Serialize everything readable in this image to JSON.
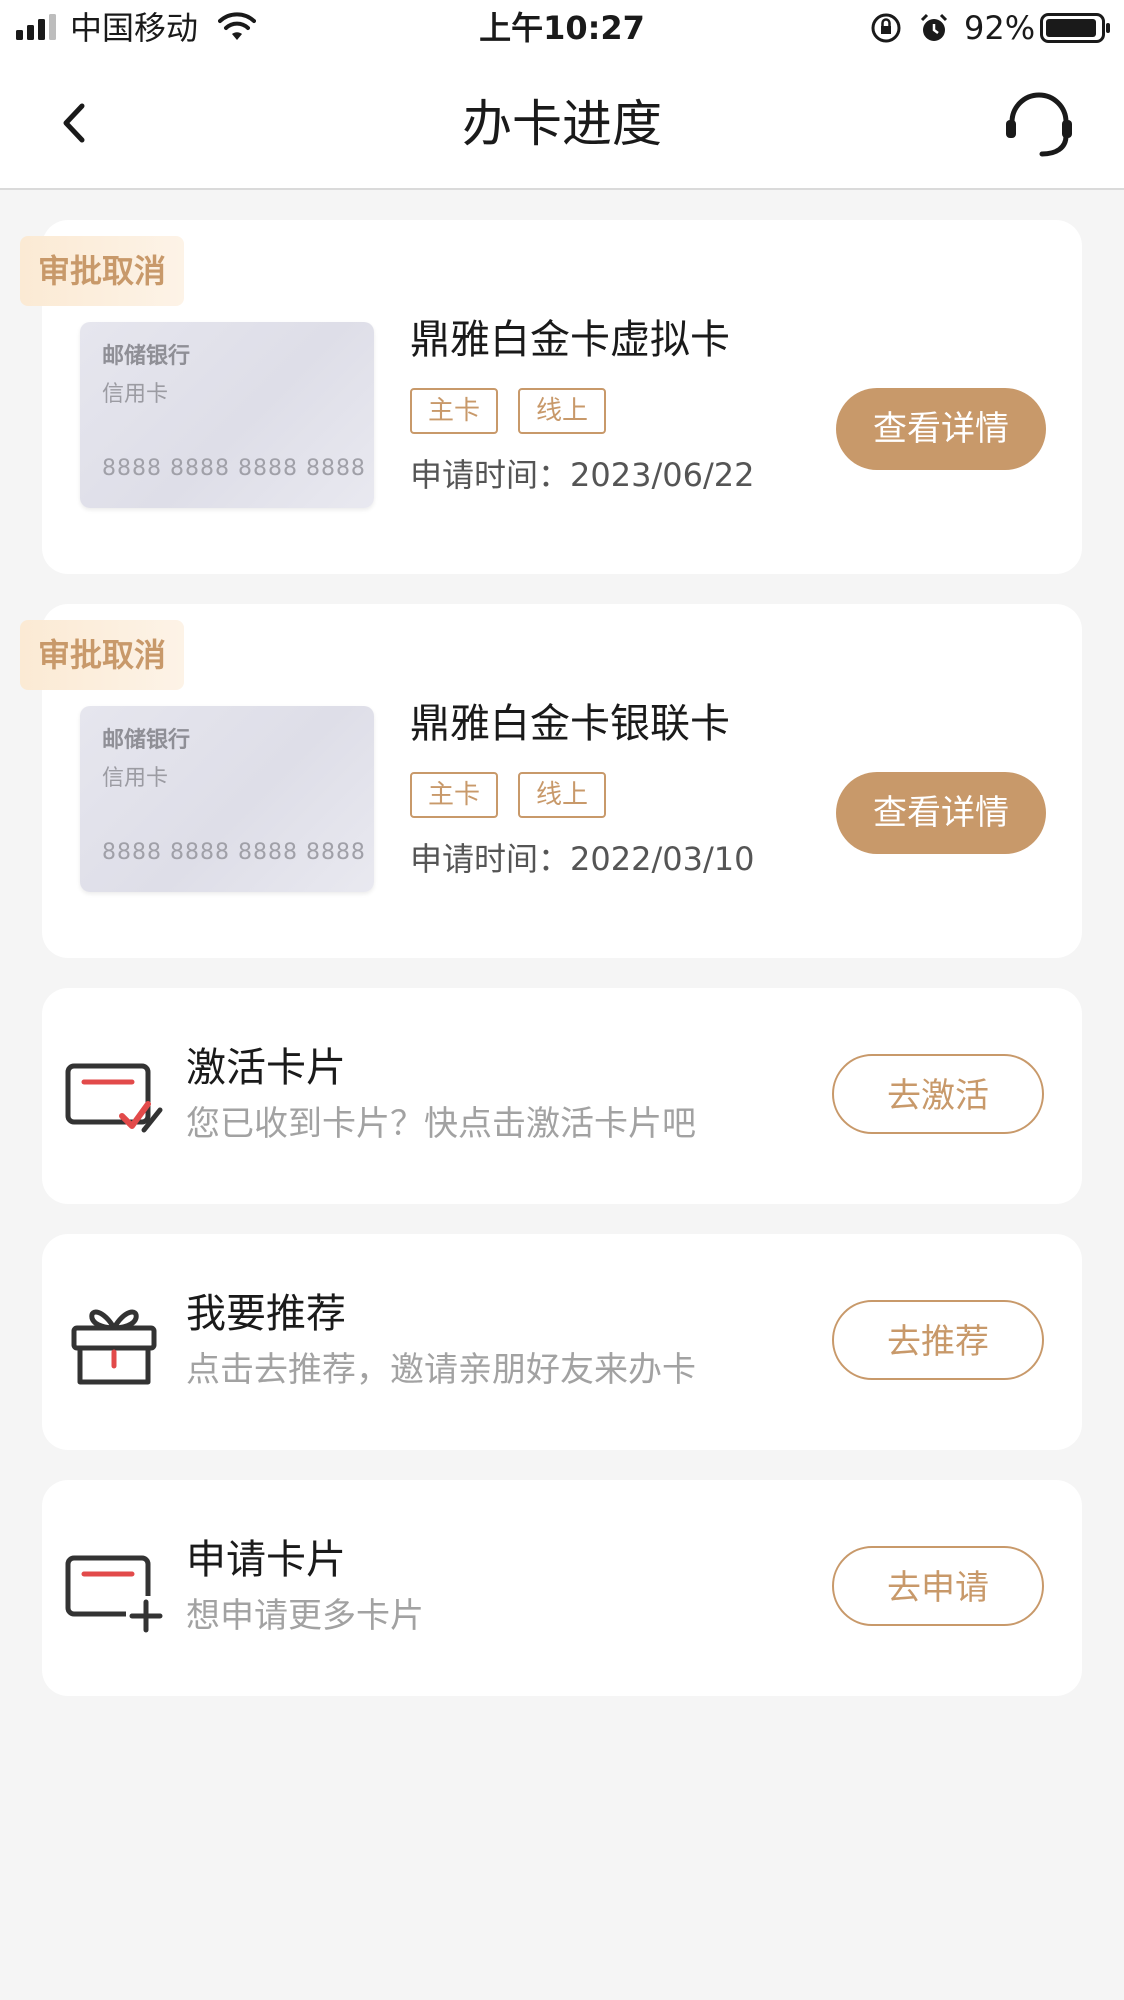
{
  "status_bar": {
    "carrier": "中国移动",
    "time": "上午10:27",
    "battery": "92%"
  },
  "nav": {
    "title": "办卡进度"
  },
  "applications": [
    {
      "status": "审批取消",
      "card_bank": "邮储银行",
      "card_type": "信用卡",
      "card_number": "8888 8888 8888 8888",
      "name": "鼎雅白金卡虚拟卡",
      "tags": [
        "主卡",
        "线上"
      ],
      "apply_time": "申请时间：2023/06/22",
      "button": "查看详情"
    },
    {
      "status": "审批取消",
      "card_bank": "邮储银行",
      "card_type": "信用卡",
      "card_number": "8888 8888 8888 8888",
      "name": "鼎雅白金卡银联卡",
      "tags": [
        "主卡",
        "线上"
      ],
      "apply_time": "申请时间：2022/03/10",
      "button": "查看详情"
    }
  ],
  "actions": [
    {
      "icon": "card-check-icon",
      "title": "激活卡片",
      "desc": "您已收到卡片？快点击激活卡片吧",
      "button": "去激活"
    },
    {
      "icon": "gift-icon",
      "title": "我要推荐",
      "desc": "点击去推荐，邀请亲朋好友来办卡",
      "button": "去推荐"
    },
    {
      "icon": "card-add-icon",
      "title": "申请卡片",
      "desc": "想申请更多卡片",
      "button": "去申请"
    }
  ],
  "colors": {
    "accent": "#c8996a",
    "background": "#f5f5f5",
    "icon_red": "#e24a4a"
  }
}
